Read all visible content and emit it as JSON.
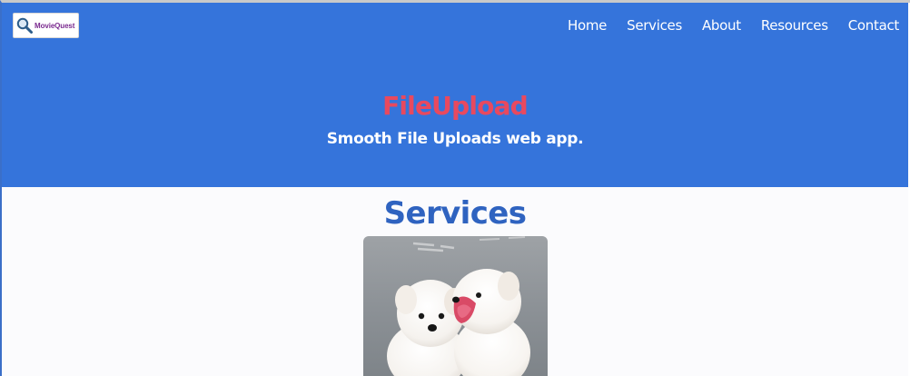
{
  "brand": {
    "logo_text": "MovieQuest",
    "logo_icon": "magnifier-icon",
    "header_color": "#3574db"
  },
  "nav": {
    "items": [
      {
        "label": "Home"
      },
      {
        "label": "Services"
      },
      {
        "label": "About"
      },
      {
        "label": "Resources"
      },
      {
        "label": "Contact"
      }
    ]
  },
  "hero": {
    "title": "FileUpload",
    "subtitle": "Smooth File Uploads web app.",
    "title_color": "#e8495f"
  },
  "services": {
    "heading": "Services",
    "heading_color": "#2f63c0",
    "image_subject": "two-white-puppies-photo"
  }
}
